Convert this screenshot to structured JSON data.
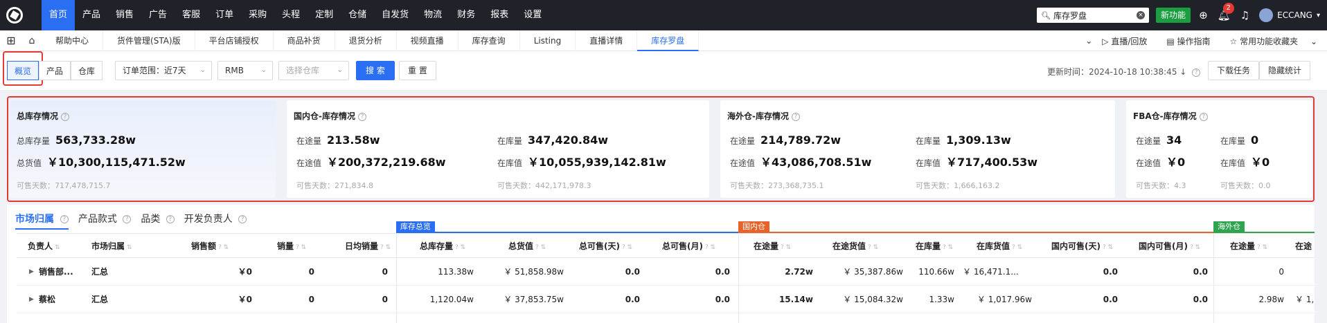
{
  "topnav": {
    "menu": [
      "首页",
      "产品",
      "销售",
      "广告",
      "客服",
      "订单",
      "采购",
      "头程",
      "定制",
      "仓储",
      "自发货",
      "物流",
      "财务",
      "报表",
      "设置"
    ],
    "active_menu": "首页",
    "search_value": "库存罗盘",
    "new_feature_label": "新功能",
    "notification_count": "2",
    "username": "ECCANG"
  },
  "tabbar": {
    "tabs": [
      "帮助中心",
      "货件管理(STA)版",
      "平台店铺授权",
      "商品补货",
      "退货分析",
      "视频直播",
      "库存查询",
      "Listing",
      "直播详情",
      "库存罗盘"
    ],
    "active_tab": "库存罗盘",
    "right": {
      "live": "直播/回放",
      "guide": "操作指南",
      "favorites": "常用功能收藏夹"
    }
  },
  "filters": {
    "view_tabs": [
      "概览",
      "产品",
      "仓库"
    ],
    "active_view": "概览",
    "order_range": "订单范围：近7天",
    "currency": "RMB",
    "warehouse_placeholder": "选择仓库",
    "search_button": "搜 索",
    "reset_button": "重 置",
    "update_time": "更新时间：2024-10-18 10:38:45",
    "download_button": "下载任务",
    "hide_button": "隐藏统计"
  },
  "cards": {
    "total": {
      "title": "总库存情况",
      "stock_label": "总库存量",
      "stock_value": "563,733.28w",
      "value_label": "总货值",
      "value_value": "￥10,300,115,471.52w",
      "days": "可售天数：717,478,715.7"
    },
    "domestic": {
      "title": "国内仓-库存情况",
      "transit_label": "在途量",
      "transit_value": "213.58w",
      "instock_label": "在库量",
      "instock_value": "347,420.84w",
      "transit_val_label": "在途值",
      "transit_val_value": "￥200,372,219.68w",
      "instock_val_label": "在库值",
      "instock_val_value": "￥10,055,939,142.81w",
      "days1": "可售天数：271,834.8",
      "days2": "可售天数：442,171,978.3"
    },
    "overseas": {
      "title": "海外仓-库存情况",
      "transit_label": "在途量",
      "transit_value": "214,789.72w",
      "instock_label": "在库量",
      "instock_value": "1,309.13w",
      "transit_val_label": "在途值",
      "transit_val_value": "￥43,086,708.51w",
      "instock_val_label": "在库值",
      "instock_val_value": "￥717,400.53w",
      "days1": "可售天数：273,368,735.1",
      "days2": "可售天数：1,666,163.2"
    },
    "fba": {
      "title": "FBA仓-库存情况",
      "transit_label": "在途量",
      "transit_value": "34",
      "instock_label": "在库量",
      "instock_value": "0",
      "transit_val_label": "在途值",
      "transit_val_value": "￥0",
      "instock_val_label": "在库值",
      "instock_val_value": "￥0",
      "days1": "可售天数：4.3",
      "days2": "可售天数：0.0"
    }
  },
  "table": {
    "subtabs": [
      "市场归属",
      "产品款式",
      "品类",
      "开发负责人"
    ],
    "active_subtab": "市场归属",
    "groups": {
      "total": "库存总览",
      "domestic": "国内仓",
      "overseas": "海外仓"
    },
    "group_colors": {
      "total": "#2a6ff3",
      "domestic": "#e8632a",
      "overseas": "#2ea44f"
    },
    "headers": [
      "负责人",
      "市场归属",
      "销售额",
      "销量",
      "日均销量",
      "总库存量",
      "总货值",
      "总可售(天)",
      "总可售(月)",
      "在途量",
      "在途货值",
      "在库量",
      "在库货值",
      "国内可售(天)",
      "国内可售(月)",
      "在途量",
      "在途"
    ],
    "rows": [
      [
        "销售部...",
        "汇总",
        "￥0",
        "0",
        "0",
        "113.38w",
        "￥ 51,858.98w",
        "0.0",
        "0.0",
        "2.72w",
        "￥ 35,387.86w",
        "110.66w",
        "￥ 16,471.1...",
        "0.0",
        "0.0",
        "0",
        ""
      ],
      [
        "蔡松",
        "汇总",
        "￥0",
        "0",
        "0",
        "1,120.04w",
        "￥ 37,853.75w",
        "0.0",
        "0.0",
        "15.14w",
        "￥ 15,084.32w",
        "1.33w",
        "￥ 1,017.96w",
        "0.0",
        "0.0",
        "2.98w",
        "￥ 1,"
      ]
    ]
  }
}
